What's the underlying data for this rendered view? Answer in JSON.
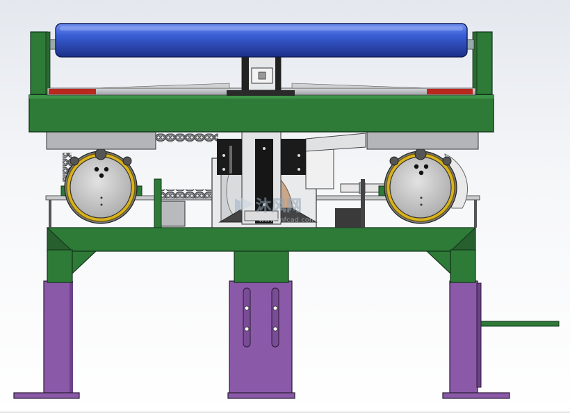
{
  "watermark": {
    "brand": "沐风网",
    "url": "www.mfcad.com"
  },
  "colors": {
    "background_top": "#e4e8ee",
    "frame_green": "#2e7a37",
    "roller_blue": "#2e50c8",
    "leg_purple": "#8a5aa8",
    "wheel_yellow": "#d9b21c",
    "accent_red": "#b8281c",
    "steel_gray": "#b8babd"
  },
  "components": {
    "roller": "blue-conveyor-roller",
    "frame": "green-frame",
    "wheels": [
      "left-drive-wheel",
      "right-drive-wheel"
    ],
    "chain": "drive-chain",
    "legs": [
      "left-leg",
      "center-leg",
      "right-leg"
    ],
    "handle": "side-handle"
  }
}
